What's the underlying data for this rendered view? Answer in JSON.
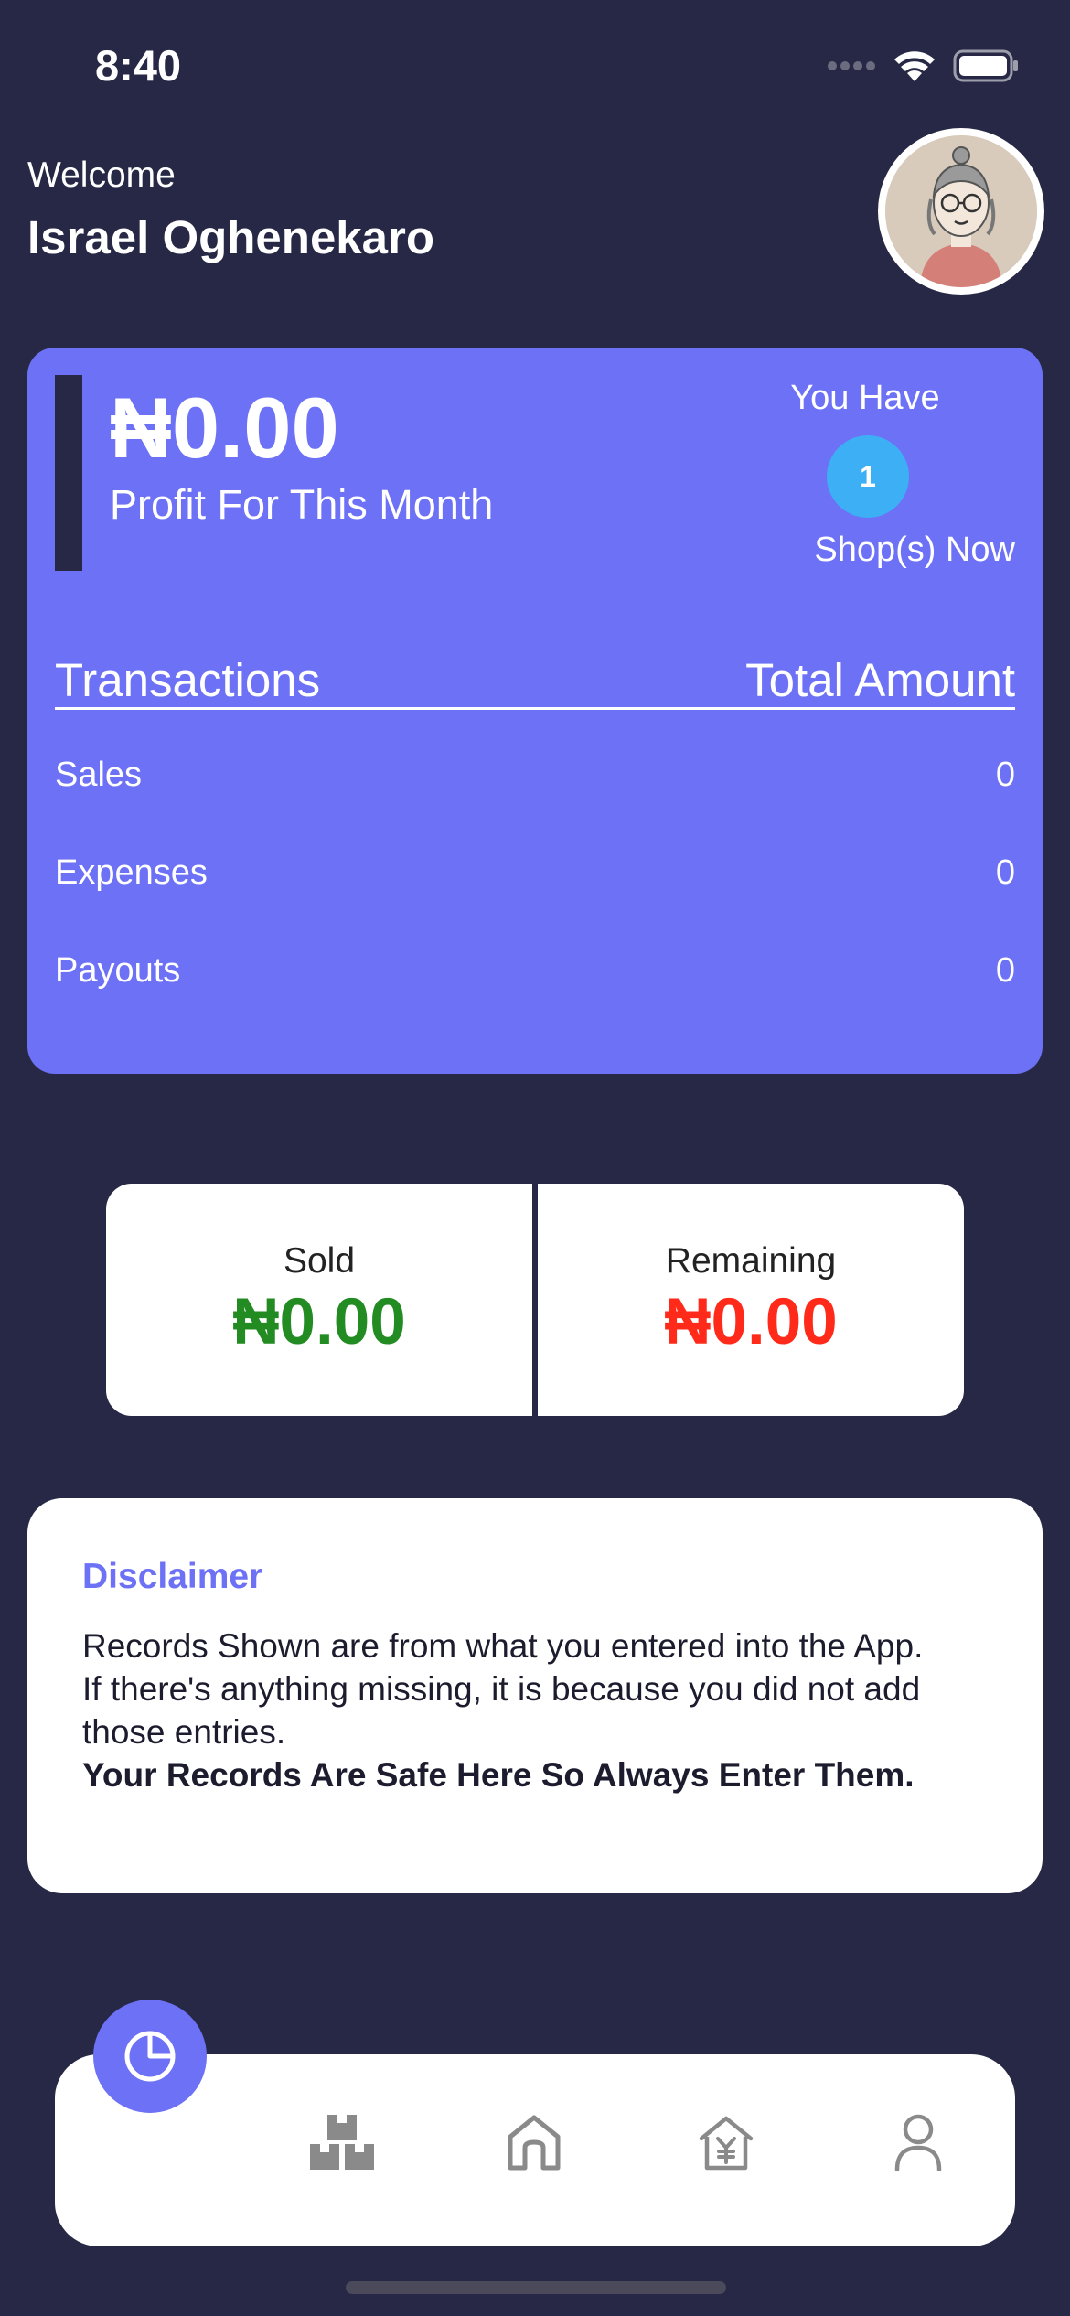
{
  "status_bar": {
    "time": "8:40"
  },
  "header": {
    "welcome": "Welcome",
    "user_name": "Israel Oghenekaro"
  },
  "profit_card": {
    "amount": "₦0.00",
    "caption": "Profit For This Month",
    "shops_prefix": "You Have",
    "shop_count": "1",
    "shops_suffix": "Shop(s) Now",
    "table": {
      "col_left": "Transactions",
      "col_right": "Total Amount",
      "rows": [
        {
          "label": "Sales",
          "value": "0"
        },
        {
          "label": "Expenses",
          "value": "0"
        },
        {
          "label": "Payouts",
          "value": "0"
        }
      ]
    }
  },
  "stats": {
    "sold_label": "Sold",
    "sold_value": "₦0.00",
    "remaining_label": "Remaining",
    "remaining_value": "₦0.00"
  },
  "disclaimer": {
    "title": "Disclaimer",
    "line1": "Records Shown are from what you entered into the App.",
    "line2": "If there's anything missing, it is because you did not add those entries.",
    "line3": "Your Records Are Safe Here So Always Enter Them."
  },
  "nav": {
    "icons": [
      "pie-chart-icon",
      "boxes-icon",
      "home-icon",
      "shop-money-icon",
      "profile-icon"
    ]
  },
  "colors": {
    "background": "#272845",
    "accent": "#6c71f5",
    "badge": "#3daff5",
    "sold": "#228b22",
    "remaining": "#ff2a1a"
  }
}
